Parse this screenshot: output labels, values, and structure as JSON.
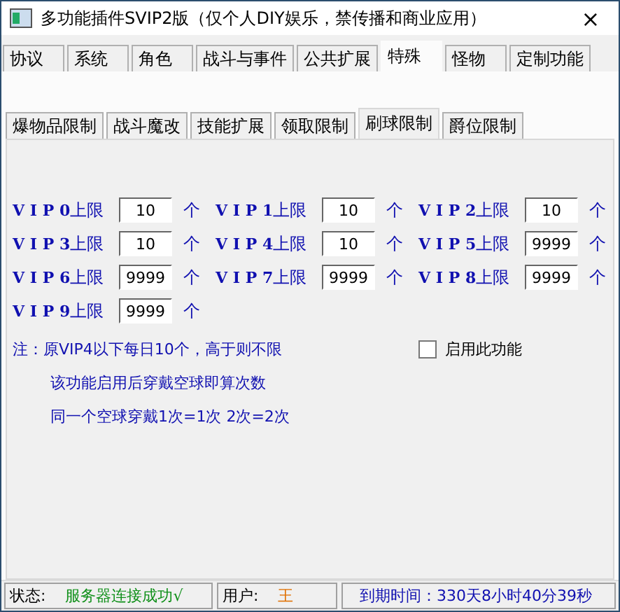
{
  "window": {
    "title": "多功能插件SVIP2版（仅个人DIY娱乐，禁传播和商业应用）",
    "close": "×"
  },
  "tabs": [
    {
      "label": "协议",
      "selected": false
    },
    {
      "label": "系统",
      "selected": false
    },
    {
      "label": "角色",
      "selected": false
    },
    {
      "label": "战斗与事件",
      "selected": false
    },
    {
      "label": "公共扩展",
      "selected": false
    },
    {
      "label": "特殊",
      "selected": true
    },
    {
      "label": "怪物",
      "selected": false
    },
    {
      "label": "定制功能",
      "selected": false
    }
  ],
  "subtabs": [
    {
      "label": "爆物品限制",
      "selected": false
    },
    {
      "label": "战斗魔改",
      "selected": false
    },
    {
      "label": "技能扩展",
      "selected": false
    },
    {
      "label": "领取限制",
      "selected": false
    },
    {
      "label": "刷球限制",
      "selected": true
    },
    {
      "label": "爵位限制",
      "selected": false
    }
  ],
  "limits": [
    {
      "vip": "V I P 0",
      "label": "上限",
      "value": "10",
      "unit": "个"
    },
    {
      "vip": "V I P 1",
      "label": "上限",
      "value": "10",
      "unit": "个"
    },
    {
      "vip": "V I P 2",
      "label": "上限",
      "value": "10",
      "unit": "个"
    },
    {
      "vip": "V I P 3",
      "label": "上限",
      "value": "10",
      "unit": "个"
    },
    {
      "vip": "V I P 4",
      "label": "上限",
      "value": "10",
      "unit": "个"
    },
    {
      "vip": "V I P 5",
      "label": "上限",
      "value": "9999",
      "unit": "个"
    },
    {
      "vip": "V I P 6",
      "label": "上限",
      "value": "9999",
      "unit": "个"
    },
    {
      "vip": "V I P 7",
      "label": "上限",
      "value": "9999",
      "unit": "个"
    },
    {
      "vip": "V I P 8",
      "label": "上限",
      "value": "9999",
      "unit": "个"
    },
    {
      "vip": "V I P 9",
      "label": "上限",
      "value": "9999",
      "unit": "个"
    }
  ],
  "notes": [
    "注：原VIP4以下每日10个，高于则不限",
    "该功能启用后穿戴空球即算次数",
    "同一个空球穿戴1次=1次 2次=2次"
  ],
  "enable": {
    "label": "启用此功能",
    "checked": false
  },
  "status_bar": {
    "status_label": "状态:",
    "status": "服务器连接成功√",
    "user_label": "用户:",
    "user": "王",
    "expiry": "到期时间：330天8小时40分39秒"
  }
}
